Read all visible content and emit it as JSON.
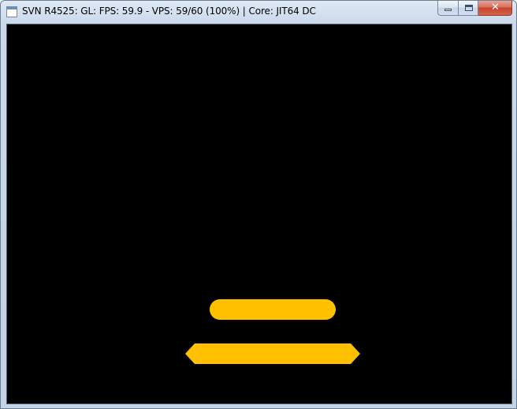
{
  "window": {
    "title": "SVN R4525: GL: FPS: 59.9 - VPS: 59/60 (100%) | Core: JIT64 DC",
    "icon": "application-icon",
    "buttons": {
      "minimize": "minimize-icon",
      "maximize": "maximize-icon",
      "close": "close-icon",
      "close_glyph": "✕"
    }
  },
  "game_view": {
    "background": "#000000",
    "shape_color": "#FFC000",
    "shapes": [
      "rounded-bar",
      "hexagon-bar"
    ]
  }
}
